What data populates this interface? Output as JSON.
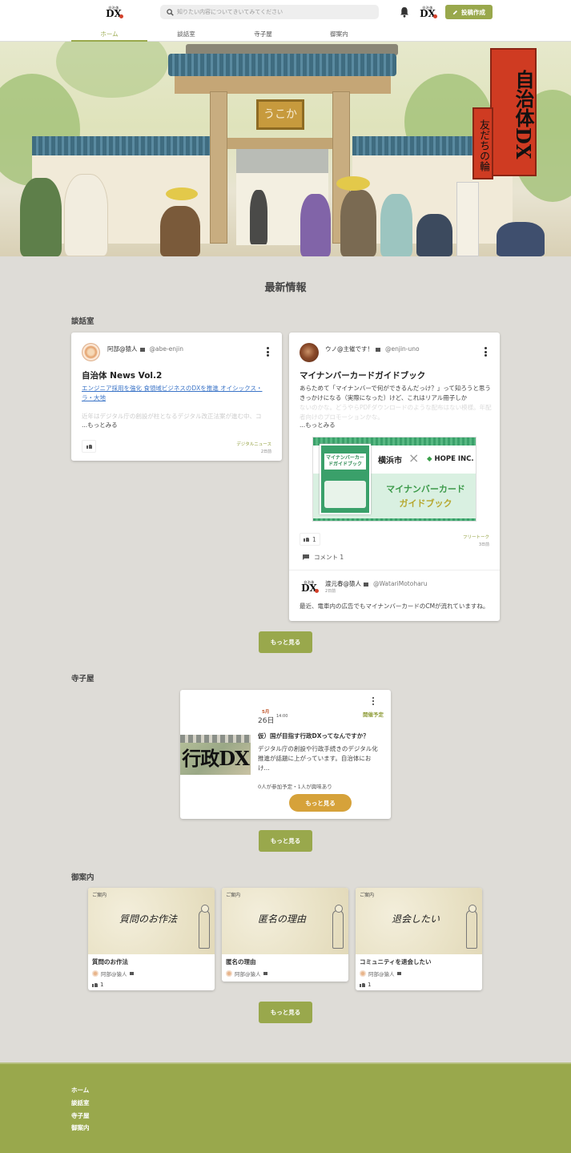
{
  "header": {
    "logo_small": "自治体",
    "logo_big": "DX",
    "search_placeholder": "知りたい内容についてきいてみてください",
    "post_button": "投稿作成",
    "nav": [
      {
        "label": "ホーム",
        "active": true
      },
      {
        "label": "談話室",
        "active": false
      },
      {
        "label": "寺子屋",
        "active": false
      },
      {
        "label": "御案内",
        "active": false
      }
    ]
  },
  "hero": {
    "plaque": "うこか",
    "sign_main": "自治体DX",
    "sign_sub": "友だちの輪"
  },
  "latest": {
    "title": "最新情報"
  },
  "danwashitsu": {
    "label": "談話室",
    "posts": [
      {
        "author": "阿部@猿人",
        "handle": "@abe-enjin",
        "title": "自治体 News Vol.2",
        "link": "エンジニア採用を強化 食領域ビジネスのDXを推進 オイシックス・ラ・大地",
        "excerpt_faded": "近年はデジタル庁の創設が柱となるデジタル改正法案が進む中、コ",
        "more": "...もっとみる",
        "tag": "デジタルニュース",
        "date": "2日前",
        "likes": ""
      },
      {
        "author": "ウノ@主催です！",
        "handle": "@enjin-uno",
        "title": "マイナンバーカードガイドブック",
        "excerpt": "あらためて「マイナンバーで何ができるんだっけ？」って知ろうと思うきっかけになる（実際になった）けど、これはリアル冊子しか",
        "excerpt_faded": "ないのかな。どうやらPDFダウンロードのような配布はない模様。年配者向けのプロモーションかな。",
        "more": "...もっとみる",
        "image": {
          "left_title": "マイナンバーカードガイドブック",
          "partners_left": "横浜市",
          "partners_x": "×",
          "partners_right": "HOPE INC.",
          "main_line1": "マイナンバーカード",
          "main_line2": "ガイドブック"
        },
        "likes": "1",
        "tag": "フリートーク",
        "date": "3日前",
        "comments": "コメント 1",
        "comment": {
          "author": "渡元春@猿人",
          "handle": "@WatariMotoharu",
          "date": "2日前",
          "text": "最近、電車内の広告でもマイナンバーカードのCMが流れていますね。"
        }
      }
    ],
    "more_button": "もっと見る"
  },
  "terakoya": {
    "label": "寺子屋",
    "event": {
      "month": "5月",
      "day": "26日",
      "time": "14:00",
      "status": "開催予定",
      "image_text": "行政DX",
      "title": "仮）国が目指す行政DXってなんですか？",
      "desc": "デジタル庁の創設や行政手続きのデジタル化推進が話題に上がっています。自治体におけ...",
      "stats": "0人が参加予定・1人が興味あり",
      "button": "もっと見る"
    },
    "more_button": "もっと見る"
  },
  "goannai": {
    "label": "御案内",
    "items": [
      {
        "img_label": "ご案内",
        "img_caption": "質問のお作法",
        "title": "質問のお作法",
        "author": "阿部@猿人",
        "likes": "1"
      },
      {
        "img_label": "ご案内",
        "img_caption": "匿名の理由",
        "title": "匿名の理由",
        "author": "阿部@猿人",
        "likes": ""
      },
      {
        "img_label": "ご案内",
        "img_caption": "退会したい",
        "title": "コミュニティを退会したい",
        "author": "阿部@猿人",
        "likes": "1"
      }
    ],
    "more_button": "もっと見る"
  },
  "footer": {
    "links": [
      "ホーム",
      "談話室",
      "寺子屋",
      "御案内"
    ]
  },
  "colors": {
    "accent": "#99a84c",
    "gold": "#d6a23a",
    "background": "#dedcd7",
    "footer": "#99a84c"
  }
}
